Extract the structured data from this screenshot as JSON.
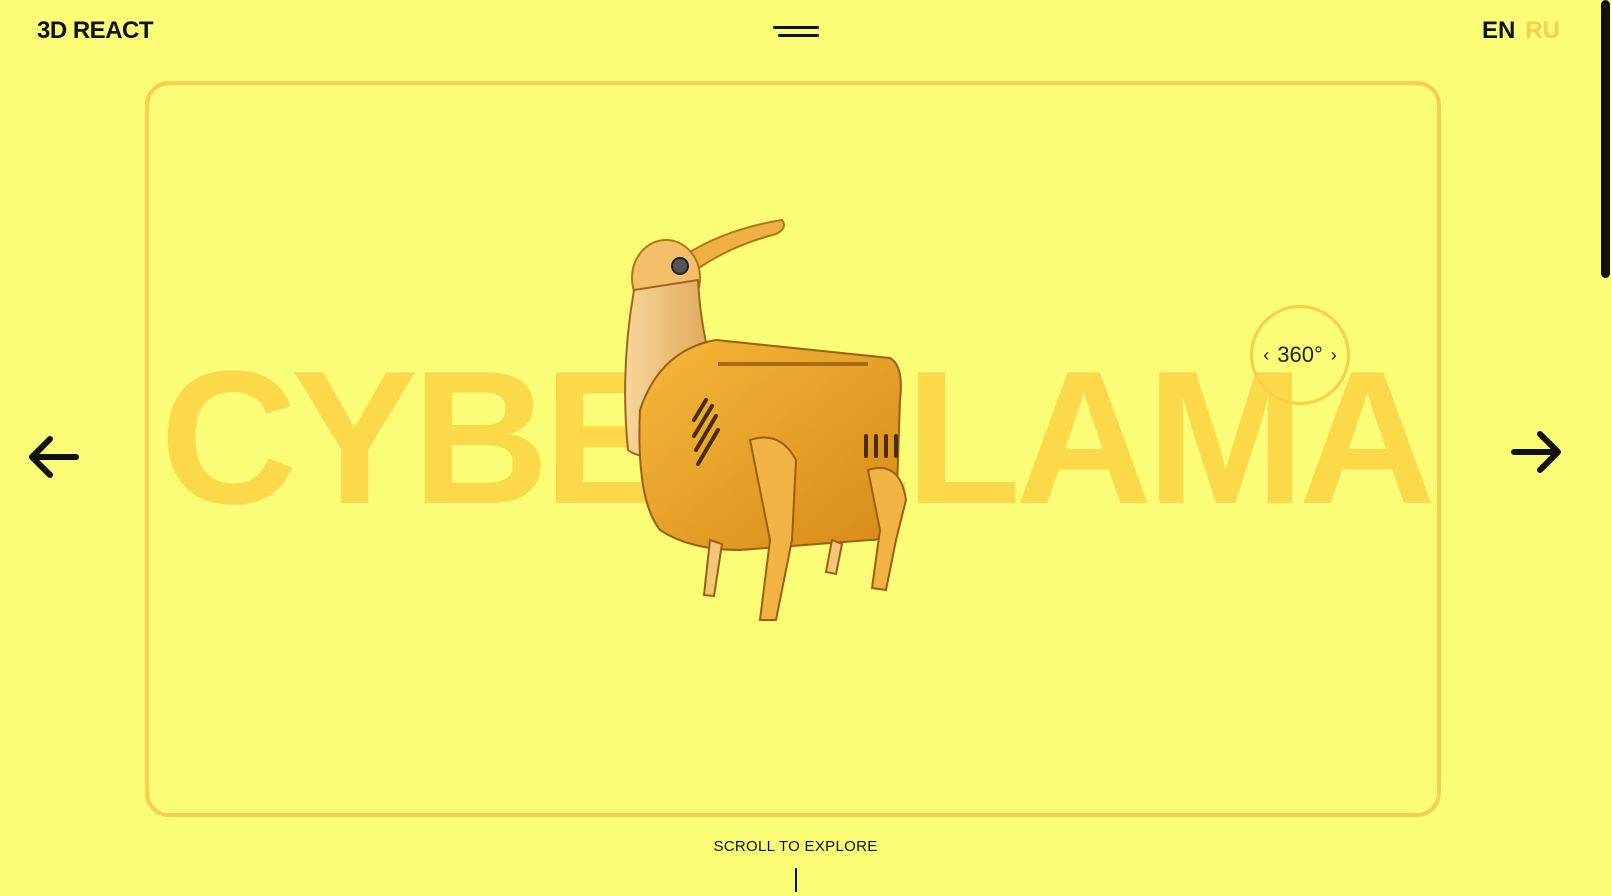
{
  "header": {
    "logo": "3D REACT",
    "languages": [
      {
        "label": "EN",
        "active": true
      },
      {
        "label": "RU",
        "active": false
      }
    ]
  },
  "hero": {
    "title": "CYBERLLAMA",
    "rotate_label": "360°",
    "rotate_prev_icon": "chevron-left-icon",
    "rotate_next_icon": "chevron-right-icon"
  },
  "navigation": {
    "prev_icon": "arrow-left-icon",
    "next_icon": "arrow-right-icon"
  },
  "footer": {
    "scroll_hint": "SCROLL TO EXPLORE"
  },
  "colors": {
    "background": "#fbfd77",
    "accent": "#fbcd4c",
    "title_text": "#fbd94a",
    "foreground": "#111111"
  }
}
